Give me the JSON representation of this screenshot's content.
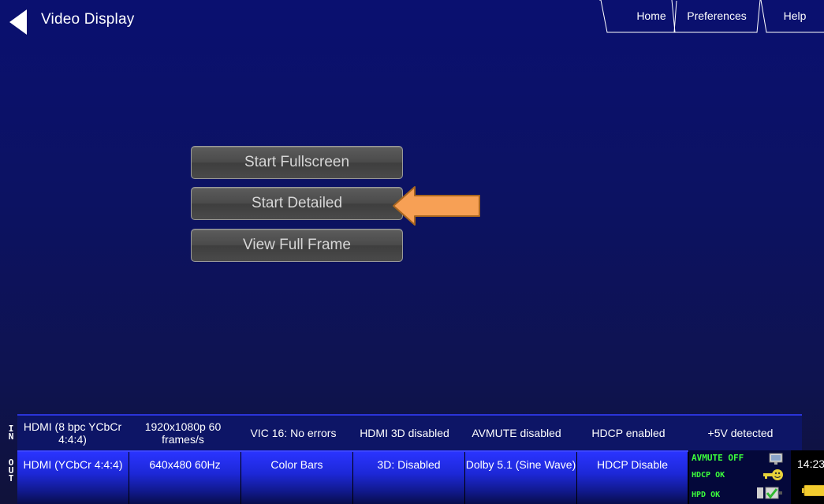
{
  "header": {
    "title": "Video Display",
    "tabs": {
      "home": "Home",
      "preferences": "Preferences",
      "help": "Help"
    }
  },
  "actions": {
    "start_fullscreen": "Start Fullscreen",
    "start_detailed": "Start Detailed",
    "view_full_frame": "View Full Frame"
  },
  "input_strip": {
    "label": "IN",
    "cells": [
      "HDMI (8 bpc YCbCr 4:4:4)",
      "1920x1080p 60 frames/s",
      "VIC 16: No errors",
      "HDMI 3D disabled",
      "AVMUTE disabled",
      "HDCP enabled",
      "+5V detected"
    ]
  },
  "output_strip": {
    "label": "OUT",
    "cells": [
      "HDMI (YCbCr 4:4:4)",
      "640x480 60Hz",
      "Color Bars",
      "3D: Disabled",
      "Dolby 5.1 (Sine Wave)",
      "HDCP Disable"
    ]
  },
  "status": {
    "avmute": "AVMUTE OFF",
    "hdcp": "HDCP OK",
    "hpd": "HPD OK",
    "time": "14:23"
  },
  "colors": {
    "background": "#0c1262",
    "status_ok": "#3cff3c",
    "highlight_arrow": "#f7a055",
    "out_cell": "#1d28d8"
  },
  "icons": {
    "back": "back-arrow-icon",
    "pointer": "pointer-arrow-icon",
    "monitor": "monitor-icon",
    "key": "hdcp-key-icon",
    "hpd": "hpd-check-icon",
    "battery": "battery-icon"
  }
}
